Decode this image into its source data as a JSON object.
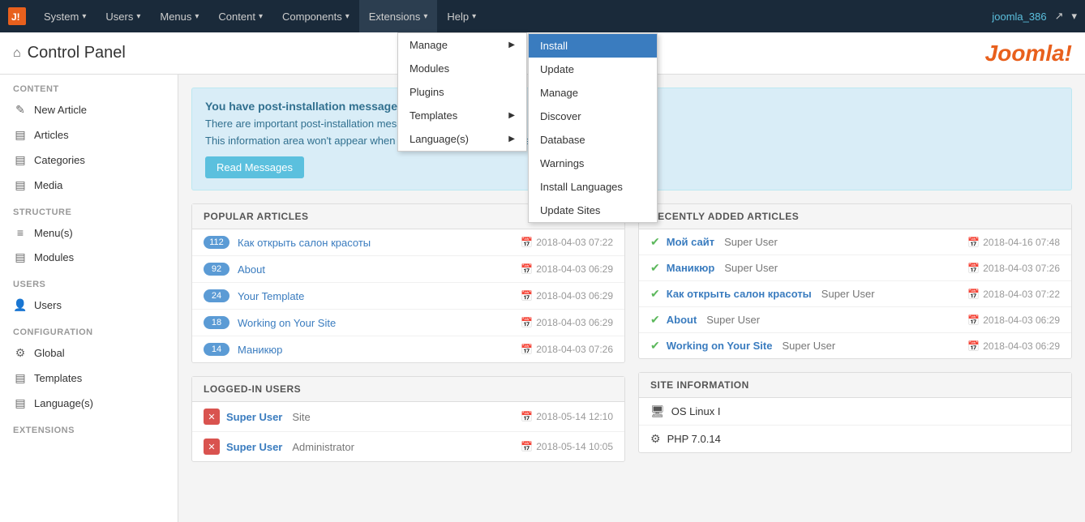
{
  "navbar": {
    "brand_icon": "✕",
    "items": [
      {
        "id": "system",
        "label": "System",
        "has_arrow": true
      },
      {
        "id": "users",
        "label": "Users",
        "has_arrow": true
      },
      {
        "id": "menus",
        "label": "Menus",
        "has_arrow": true
      },
      {
        "id": "content",
        "label": "Content",
        "has_arrow": true
      },
      {
        "id": "components",
        "label": "Components",
        "has_arrow": true
      },
      {
        "id": "extensions",
        "label": "Extensions",
        "has_arrow": true,
        "active": true
      },
      {
        "id": "help",
        "label": "Help",
        "has_arrow": true
      }
    ],
    "user_label": "joomla_386",
    "user_icon": "↗",
    "account_icon": "👤"
  },
  "extensions_dropdown": {
    "items": [
      {
        "id": "manage",
        "label": "Manage",
        "has_sub": true
      },
      {
        "id": "modules",
        "label": "Modules"
      },
      {
        "id": "plugins",
        "label": "Plugins"
      },
      {
        "id": "templates",
        "label": "Templates",
        "has_sub": true
      },
      {
        "id": "languages",
        "label": "Language(s)",
        "has_sub": true
      }
    ]
  },
  "install_submenu": {
    "items": [
      {
        "id": "install",
        "label": "Install",
        "highlighted": true
      },
      {
        "id": "update",
        "label": "Update"
      },
      {
        "id": "manage",
        "label": "Manage"
      },
      {
        "id": "discover",
        "label": "Discover"
      },
      {
        "id": "database",
        "label": "Database"
      },
      {
        "id": "warnings",
        "label": "Warnings"
      },
      {
        "id": "install_languages",
        "label": "Install Languages"
      },
      {
        "id": "update_sites",
        "label": "Update Sites"
      }
    ]
  },
  "header": {
    "home_icon": "⌂",
    "title": "Control Panel",
    "logo_text": "Joomla!"
  },
  "sidebar": {
    "sections": [
      {
        "id": "content",
        "title": "CONTENT",
        "items": [
          {
            "id": "new-article",
            "icon": "✎",
            "label": "New Article"
          },
          {
            "id": "articles",
            "icon": "▤",
            "label": "Articles"
          },
          {
            "id": "categories",
            "icon": "▤",
            "label": "Categories"
          },
          {
            "id": "media",
            "icon": "▤",
            "label": "Media"
          }
        ]
      },
      {
        "id": "structure",
        "title": "STRUCTURE",
        "items": [
          {
            "id": "menus",
            "icon": "≡",
            "label": "Menu(s)"
          },
          {
            "id": "modules",
            "icon": "▤",
            "label": "Modules"
          }
        ]
      },
      {
        "id": "users",
        "title": "USERS",
        "items": [
          {
            "id": "users",
            "icon": "👤",
            "label": "Users"
          }
        ]
      },
      {
        "id": "configuration",
        "title": "CONFIGURATION",
        "items": [
          {
            "id": "global",
            "icon": "⚙",
            "label": "Global"
          },
          {
            "id": "templates",
            "icon": "▤",
            "label": "Templates"
          },
          {
            "id": "languages",
            "icon": "▤",
            "label": "Language(s)"
          }
        ]
      },
      {
        "id": "extensions_section",
        "title": "EXTENSIONS",
        "items": []
      }
    ]
  },
  "alert": {
    "title": "You have post-installation messages",
    "text": "There are important post-installation messages that",
    "text2": "This information area won't appear when you have hidden all the messages.",
    "button": "Read Messages"
  },
  "popular_articles": {
    "header": "POPULAR ARTICLES",
    "items": [
      {
        "count": "112",
        "title": "Как открыть салон красоты",
        "date": "2018-04-03 07:22"
      },
      {
        "count": "92",
        "title": "About",
        "date": "2018-04-03 06:29"
      },
      {
        "count": "24",
        "title": "Your Template",
        "date": "2018-04-03 06:29"
      },
      {
        "count": "18",
        "title": "Working on Your Site",
        "date": "2018-04-03 06:29"
      },
      {
        "count": "14",
        "title": "Маникюр",
        "date": "2018-04-03 07:26"
      }
    ]
  },
  "recently_added": {
    "header": "RECENTLY ADDED ARTICLES",
    "items": [
      {
        "title": "Мой сайт",
        "author": "Super User",
        "date": "2018-04-16 07:48"
      },
      {
        "title": "Маникюр",
        "author": "Super User",
        "date": "2018-04-03 07:26"
      },
      {
        "title": "Как открыть салон красоты",
        "author": "Super User",
        "date": "2018-04-03 07:22"
      },
      {
        "title": "About",
        "author": "Super User",
        "date": "2018-04-03 06:29"
      },
      {
        "title": "Working on Your Site",
        "author": "Super User",
        "date": "2018-04-03 06:29"
      }
    ]
  },
  "logged_in_users": {
    "header": "LOGGED-IN USERS",
    "items": [
      {
        "name": "Super User",
        "type": "Site",
        "date": "2018-05-14 12:10"
      },
      {
        "name": "Super User",
        "type": "Administrator",
        "date": "2018-05-14 10:05"
      }
    ]
  },
  "site_information": {
    "header": "SITE INFORMATION",
    "items": [
      {
        "icon": "🖥",
        "text": "OS Linux I"
      },
      {
        "icon": "⚙",
        "text": "PHP 7.0.14"
      }
    ]
  }
}
